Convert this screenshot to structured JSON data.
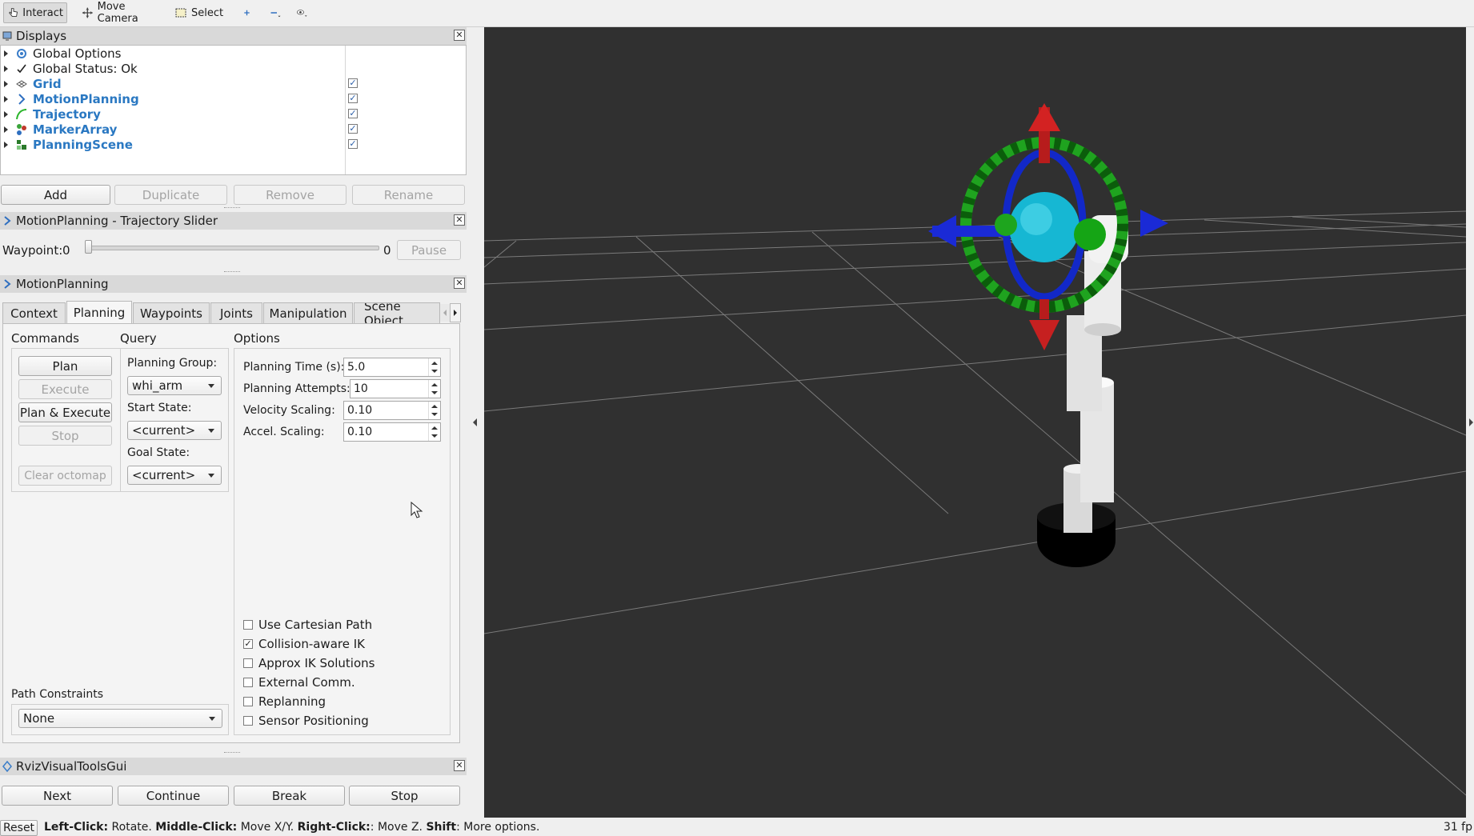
{
  "toolbar": {
    "interact": "Interact",
    "move_camera": "Move Camera",
    "select": "Select"
  },
  "displays": {
    "title": "Displays",
    "items": [
      {
        "label": "Global Options",
        "icon": "gear-icon"
      },
      {
        "label": "Global Status: Ok",
        "icon": "checkmark-icon"
      },
      {
        "label": "Grid",
        "icon": "grid-icon",
        "checked": true
      },
      {
        "label": "MotionPlanning",
        "icon": "motion-planning-icon",
        "checked": true
      },
      {
        "label": "Trajectory",
        "icon": "trajectory-icon",
        "checked": true
      },
      {
        "label": "MarkerArray",
        "icon": "marker-array-icon",
        "checked": true
      },
      {
        "label": "PlanningScene",
        "icon": "planning-scene-icon",
        "checked": true
      }
    ],
    "buttons": {
      "add": "Add",
      "duplicate": "Duplicate",
      "remove": "Remove",
      "rename": "Rename"
    }
  },
  "slider_panel": {
    "title": "MotionPlanning - Trajectory Slider",
    "waypoint_label": "Waypoint:",
    "waypoint_value": "0",
    "max_value": "0",
    "pause": "Pause"
  },
  "motion_planning": {
    "title": "MotionPlanning",
    "tabs": [
      "Context",
      "Planning",
      "Waypoints",
      "Joints",
      "Manipulation",
      "Scene Object"
    ],
    "selected_tab": "Planning",
    "commands": {
      "label": "Commands",
      "plan": "Plan",
      "execute": "Execute",
      "plan_execute": "Plan & Execute",
      "stop": "Stop",
      "clear_octomap": "Clear octomap"
    },
    "query": {
      "label": "Query",
      "planning_group_label": "Planning Group:",
      "planning_group": "whi_arm",
      "start_state_label": "Start State:",
      "start_state": "<current>",
      "goal_state_label": "Goal State:",
      "goal_state": "<current>"
    },
    "options": {
      "label": "Options",
      "planning_time_label": "Planning Time (s):",
      "planning_time": "5.0",
      "planning_attempts_label": "Planning Attempts:",
      "planning_attempts": "10",
      "velocity_scaling_label": "Velocity Scaling:",
      "velocity_scaling": "0.10",
      "accel_scaling_label": "Accel. Scaling:",
      "accel_scaling": "0.10",
      "checkboxes": [
        {
          "label": "Use Cartesian Path",
          "checked": false
        },
        {
          "label": "Collision-aware IK",
          "checked": true
        },
        {
          "label": "Approx IK Solutions",
          "checked": false
        },
        {
          "label": "External Comm.",
          "checked": false
        },
        {
          "label": "Replanning",
          "checked": false
        },
        {
          "label": "Sensor Positioning",
          "checked": false
        }
      ]
    },
    "path_constraints_label": "Path Constraints",
    "path_constraints": "None"
  },
  "rviz_tools": {
    "title": "RvizVisualToolsGui",
    "next": "Next",
    "continue": "Continue",
    "break": "Break",
    "stop": "Stop"
  },
  "statusbar": {
    "reset": "Reset",
    "left_click": "Left-Click:",
    "left_action": " Rotate. ",
    "middle_click": "Middle-Click:",
    "middle_action": " Move X/Y. ",
    "right_click": "Right-Click:",
    "right_action": ": Move Z. ",
    "shift": "Shift",
    "shift_action": ": More options.",
    "fps": "31 fp"
  },
  "colors": {
    "viewport_bg": "#303030",
    "display_label_blue": "#2a78c2"
  }
}
